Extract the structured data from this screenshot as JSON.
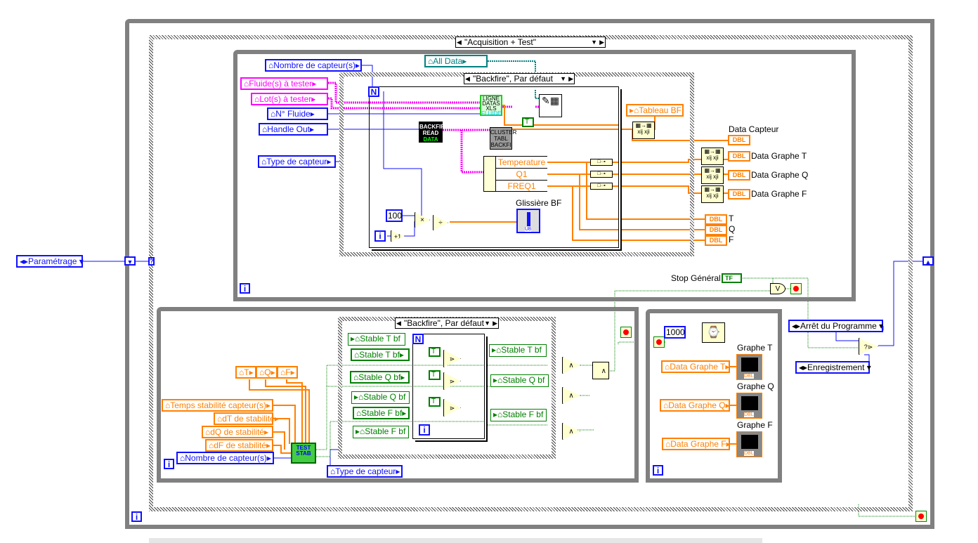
{
  "outer_case": {
    "selector": "\"Acquisition + Test\""
  },
  "state_enum": {
    "value": "Paramétrage"
  },
  "top_loop": {
    "case_selector": "\"Backfire\", Par défaut",
    "controls": {
      "nombre_capteurs": "Nombre de capteur(s)",
      "fluides": "Fluide(s) à tester",
      "lots": "Lot(s) à tester",
      "n_fluide": "N° Fluide",
      "handle_out": "Handle Out",
      "type_capteur": "Type de capteur",
      "all_data": "All Data",
      "tableau_bf": "Tableau BF"
    },
    "for_loop": {
      "count_terminal": "N",
      "iteration_terminal": "i",
      "constant": "100"
    },
    "subvis": {
      "backfire_read": [
        "BACKFIR",
        "READ",
        "DATA"
      ],
      "ligne_datas": [
        "LIGNE",
        "DATAS",
        "XLS",
        "FLUIDE"
      ],
      "cluster_tabl": [
        "CLUSTER",
        "TABL",
        "BACKFI"
      ]
    },
    "unbundle": [
      "Temperature",
      "Q1",
      "FREQ1"
    ],
    "slider_label": "Glissière BF",
    "slider_type": "U8",
    "indicators": {
      "data_capteur": "Data Capteur",
      "data_graphe_t": "Data Graphe T",
      "data_graphe_q": "Data Graphe Q",
      "data_graphe_f": "Data Graphe F",
      "t": "T",
      "q": "Q",
      "f": "F",
      "type": "DBL"
    },
    "loop_iteration": "i"
  },
  "stop": {
    "label": "Stop Général",
    "terminal": "TF",
    "or_symbol": "V"
  },
  "bottom_left_loop": {
    "case_selector": "\"Backfire\", Par défaut",
    "controls": {
      "t": "T",
      "q": "Q",
      "f": "F",
      "temps_stabilite": "Temps stabilité capteur(s)",
      "dt": "dT de stabilité",
      "dq": "dQ de stabilité",
      "df": "dF de stabilité",
      "nombre_capteurs": "Nombre de capteur(s)",
      "type_capteur": "Type de capteur"
    },
    "test_stab": [
      "TEST",
      "STAB"
    ],
    "locals_in": [
      "Stable T bf",
      "Stable T bf",
      "Stable Q bf",
      "Stable Q bf",
      "Stable F bf",
      "Stable F bf"
    ],
    "locals_out": [
      "Stable T bf",
      "Stable Q bf",
      "Stable F bf"
    ],
    "true_constant": "T",
    "and_symbol": "∧",
    "for_count": "N",
    "for_iteration": "i",
    "loop_iteration": "i"
  },
  "bottom_right_loop": {
    "wait_ms": "1000",
    "graphs": [
      {
        "label": "Graphe T",
        "input": "Data Graphe T"
      },
      {
        "label": "Graphe Q",
        "input": "Data Graphe Q"
      },
      {
        "label": "Graphe F",
        "input": "Data Graphe F"
      }
    ],
    "graph_type": "DBL",
    "loop_iteration": "i"
  },
  "right_side": {
    "arret": "Arrêt du Programme",
    "enregistrement": "Enregistrement"
  },
  "outer_loop": {
    "iteration": "i"
  },
  "colors": {
    "integer": "#1010ff",
    "double": "#ff8000",
    "string": "#ff00ff",
    "boolean": "#008000",
    "cluster": "#008080",
    "structure": "#808080"
  }
}
